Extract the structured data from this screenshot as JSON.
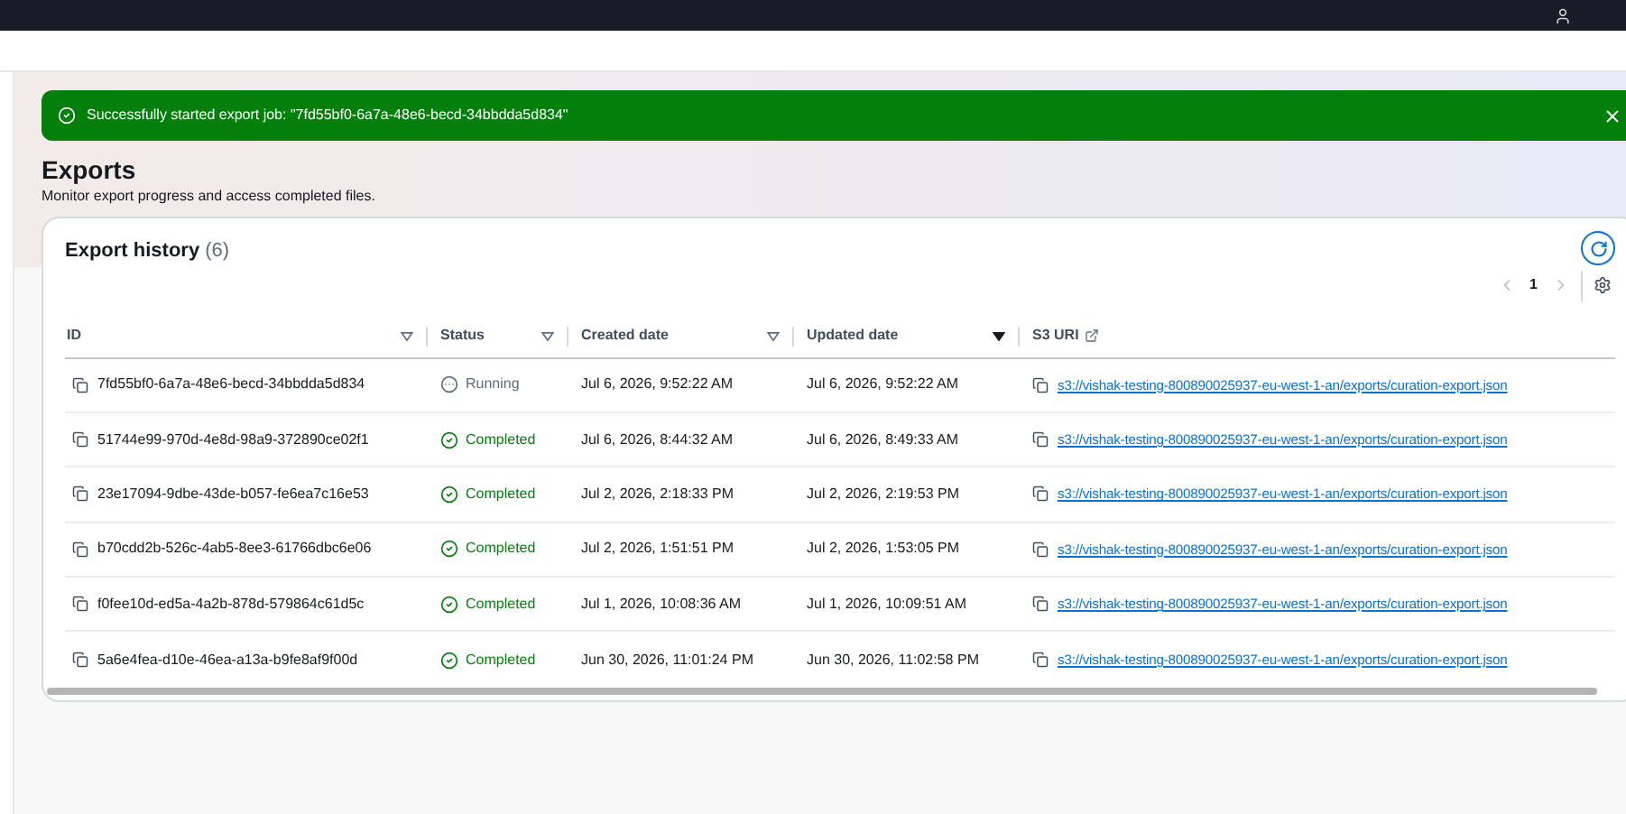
{
  "flash": {
    "message": "Successfully started export job: \"7fd55bf0-6a7a-48e6-becd-34bbdda5d834\""
  },
  "page": {
    "title": "Exports",
    "description": "Monitor export progress and access completed files."
  },
  "table": {
    "title": "Export history",
    "count": "(6)",
    "pagination": {
      "page": "1"
    },
    "columns": [
      {
        "label": "ID",
        "kind": "sortable",
        "sorted": false
      },
      {
        "label": "Status",
        "kind": "sortable",
        "sorted": false
      },
      {
        "label": "Created date",
        "kind": "sortable",
        "sorted": false
      },
      {
        "label": "Updated date",
        "kind": "sortable",
        "sorted": true
      },
      {
        "label": "S3 URI",
        "kind": "external"
      }
    ],
    "rows": [
      {
        "id": "7fd55bf0-6a7a-48e6-becd-34bbdda5d834",
        "status": {
          "kind": "running",
          "label": "Running"
        },
        "created": "Jul 6, 2026, 9:52:22 AM",
        "updated": "Jul 6, 2026, 9:52:22 AM",
        "uri": "s3://vishak-testing-800890025937-eu-west-1-an/exports/curation-export.json"
      },
      {
        "id": "51744e99-970d-4e8d-98a9-372890ce02f1",
        "status": {
          "kind": "completed",
          "label": "Completed"
        },
        "created": "Jul 6, 2026, 8:44:32 AM",
        "updated": "Jul 6, 2026, 8:49:33 AM",
        "uri": "s3://vishak-testing-800890025937-eu-west-1-an/exports/curation-export.json"
      },
      {
        "id": "23e17094-9dbe-43de-b057-fe6ea7c16e53",
        "status": {
          "kind": "completed",
          "label": "Completed"
        },
        "created": "Jul 2, 2026, 2:18:33 PM",
        "updated": "Jul 2, 2026, 2:19:53 PM",
        "uri": "s3://vishak-testing-800890025937-eu-west-1-an/exports/curation-export.json"
      },
      {
        "id": "b70cdd2b-526c-4ab5-8ee3-61766dbc6e06",
        "status": {
          "kind": "completed",
          "label": "Completed"
        },
        "created": "Jul 2, 2026, 1:51:51 PM",
        "updated": "Jul 2, 2026, 1:53:05 PM",
        "uri": "s3://vishak-testing-800890025937-eu-west-1-an/exports/curation-export.json"
      },
      {
        "id": "f0fee10d-ed5a-4a2b-878d-579864c61d5c",
        "status": {
          "kind": "completed",
          "label": "Completed"
        },
        "created": "Jul 1, 2026, 10:08:36 AM",
        "updated": "Jul 1, 2026, 10:09:51 AM",
        "uri": "s3://vishak-testing-800890025937-eu-west-1-an/exports/curation-export.json"
      },
      {
        "id": "5a6e4fea-d10e-46ea-a13a-b9fe8af9f00d",
        "status": {
          "kind": "completed",
          "label": "Completed"
        },
        "created": "Jun 30, 2026, 11:01:24 PM",
        "updated": "Jun 30, 2026, 11:02:58 PM",
        "uri": "s3://vishak-testing-800890025937-eu-west-1-an/exports/curation-export.json"
      }
    ]
  }
}
